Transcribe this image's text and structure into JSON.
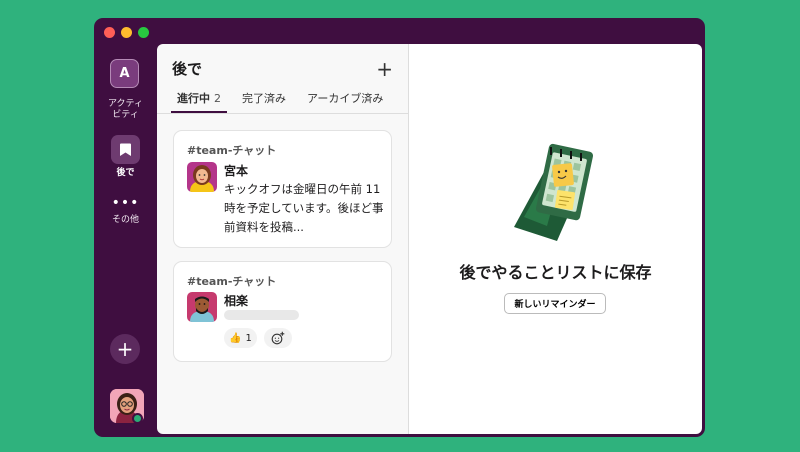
{
  "workspace": {
    "initial": "A"
  },
  "rail": {
    "activity_label": "アクティ\nビティ",
    "later_label": "後で",
    "more_label": "その他"
  },
  "later_panel": {
    "title": "後で",
    "tabs": [
      {
        "label": "進行中",
        "count": "2",
        "active": true
      },
      {
        "label": "完了済み",
        "active": false
      },
      {
        "label": "アーカイブ済み",
        "active": false
      }
    ],
    "items": [
      {
        "channel": "#team-チャット",
        "sender": "宮本",
        "message": "キックオフは金曜日の午前 11 時を予定しています。後ほど事前資料を投稿..."
      },
      {
        "channel": "#team-チャット",
        "sender": "相楽",
        "reactions": [
          {
            "emoji": "👍",
            "count": "1"
          }
        ]
      }
    ]
  },
  "empty_state": {
    "title": "後でやることリストに保存",
    "button_label": "新しいリマインダー"
  },
  "colors": {
    "background": "#2fb27d",
    "sidebar": "#3f0e40",
    "accent": "#3f0e40"
  },
  "icons": [
    "bookmark-icon",
    "plus-icon",
    "add-reaction-icon",
    "more-icon"
  ]
}
